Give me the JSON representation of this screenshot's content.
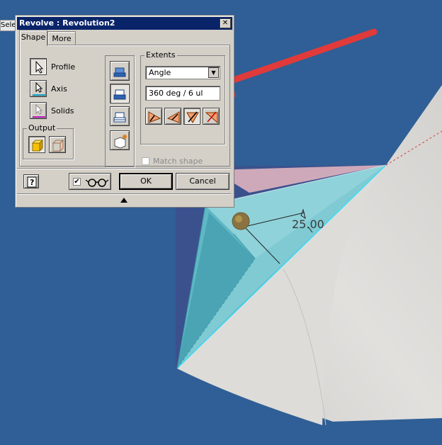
{
  "window": {
    "title": "Revolve : Revolution2",
    "close_glyph": "✕"
  },
  "behind": {
    "partial_label": "Selec"
  },
  "tabs": [
    {
      "label": "Shape"
    },
    {
      "label": "More"
    }
  ],
  "shape": {
    "profile_label": "Profile",
    "axis_label": "Axis",
    "solids_label": "Solids",
    "output_label": "Output"
  },
  "extents": {
    "label": "Extents",
    "type_value": "Angle",
    "angle_value": "360 deg / 6 ul"
  },
  "match_shape": {
    "label": "Match shape",
    "checked": false
  },
  "footer": {
    "help_glyph": "?",
    "preview_checked_glyph": "✔",
    "ok_label": "OK",
    "cancel_label": "Cancel"
  },
  "viewport": {
    "dimension_value": "25.00"
  },
  "colors": {
    "viewport_bg": "#2f5f96",
    "title_bar": "#0a246a",
    "annotation_arrow": "#e03a3a"
  }
}
